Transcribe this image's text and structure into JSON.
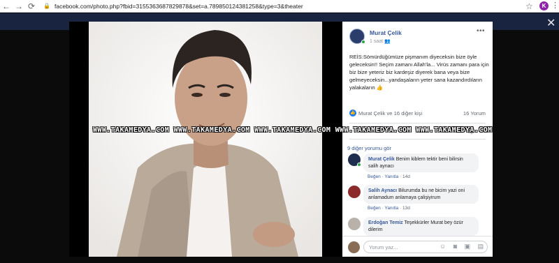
{
  "browser": {
    "url": "facebook.com/photo.php?fbid=3155363687829878&set=a.789850124381258&type=3&theater",
    "profile_initial": "K"
  },
  "post": {
    "author": "Murat Çelik",
    "time": "1 saat",
    "text": "REİS:Sömürdüğümüze pişmanım diyeceksin bize öyle geleceksin!! Seçim zamanı Allah'la... Virüs zamanı para için biz bize yeteriz biz kardeşiz diyerek bana veya bize gelmeyeceksin...yandaşaların yeter sana kazandırdıların yalakaların 👍",
    "likes": "Murat Çelik ve 16 diğer kişi",
    "comments_count": "16 Yorum",
    "action_fragment": "ap"
  },
  "comments": {
    "view_more": "9 diğer yorumu gör",
    "items": [
      {
        "name": "Murat Çelik",
        "text": "Benim kiblem tektir beni bilirsin salih aynacı",
        "like": "Beğen",
        "reply": "Yanıtla",
        "time": "14d"
      },
      {
        "name": "Salih Aynacı",
        "text": "Bilurumda bu ne bicim yazi oni anlamadum anlamaya çalişiyirum",
        "like": "Beğen",
        "reply": "Yanıtla",
        "time": "13d"
      },
      {
        "name": "Erdoğan Temiz",
        "text": "Teşekkürler Murat bey özür dilerim"
      }
    ]
  },
  "composer": {
    "placeholder": "Yorum yaz...",
    "icons": "☺ ◙ ▣ ▤"
  },
  "watermark": "WWW.TAKAMEDYA.COM WWW.TAKAMEDYA.COM WWW.TAKAMEDYA.COM WWW.TAKAMEDYA.COM WWW.TAKAMEDYA.COM",
  "colors": {
    "fb_blue": "#385898",
    "like_blue": "#1877f2",
    "online_green": "#31a24c"
  }
}
